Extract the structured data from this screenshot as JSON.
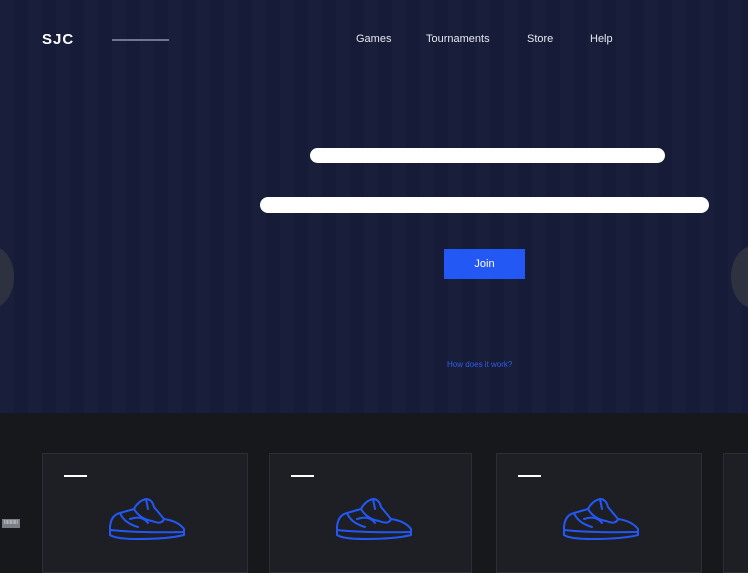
{
  "brand": {
    "logo": "SJC"
  },
  "nav": {
    "items": [
      "Games",
      "Tournaments",
      "Store",
      "Help"
    ]
  },
  "hero": {
    "join_label": "Join",
    "how_link": "How does it work?"
  },
  "cards": [
    {
      "icon": "sneaker-icon"
    },
    {
      "icon": "sneaker-icon"
    },
    {
      "icon": "sneaker-icon"
    }
  ],
  "badge": {
    "text": "IIIIIIIIII"
  },
  "colors": {
    "hero_bg": "#161c39",
    "accent": "#2458f4",
    "link": "#2f5de8",
    "page_bg": "#17181c",
    "card_bg": "#1d1f24"
  }
}
